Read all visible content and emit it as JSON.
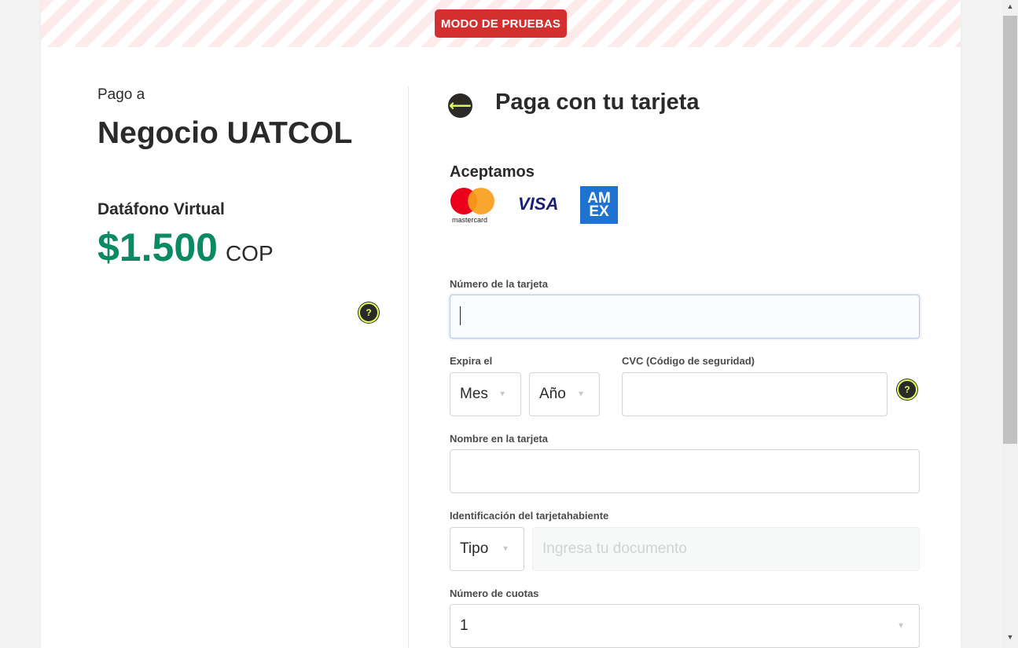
{
  "banner": {
    "label": "MODO DE PRUEBAS"
  },
  "summary": {
    "pay_to_label": "Pago a",
    "merchant_name": "Negocio UATCOL",
    "product_name": "Datáfono Virtual",
    "amount": "$1.500",
    "currency": "COP",
    "help_icon": "?"
  },
  "form": {
    "back_icon": "⟵",
    "title": "Paga con tu tarjeta",
    "accepted_title": "Aceptamos",
    "brands": {
      "mastercard": "mastercard",
      "visa": "VISA",
      "amex_line1": "AM",
      "amex_line2": "EX"
    },
    "card_number": {
      "label": "Número de la tarjeta",
      "value": ""
    },
    "expiry": {
      "label": "Expira el",
      "month": "Mes",
      "year": "Año"
    },
    "cvc": {
      "label": "CVC (Código de seguridad)",
      "value": "",
      "help_icon": "?"
    },
    "name": {
      "label": "Nombre en la tarjeta",
      "value": ""
    },
    "identification": {
      "label": "Identificación del tarjetahabiente",
      "type": "Tipo",
      "placeholder": "Ingresa tu documento"
    },
    "installments": {
      "label": "Número de cuotas",
      "value": "1"
    }
  },
  "colors": {
    "accent": "#dfff61",
    "amount_green": "#0a8a63",
    "badge_red": "#d32f2f",
    "dark": "#2c2a29"
  },
  "icons": {
    "dropdown_arrow": "▼",
    "scroll_up": "▲",
    "scroll_down": "▼"
  }
}
